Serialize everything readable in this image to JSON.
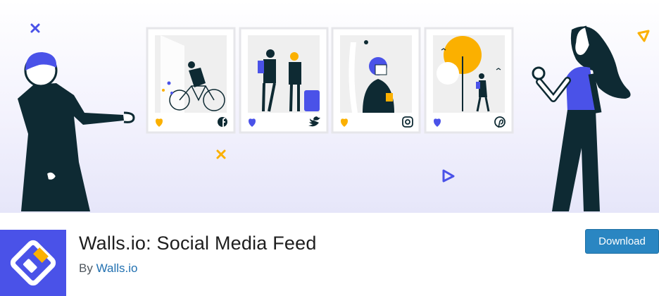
{
  "plugin": {
    "title": "Walls.io: Social Media Feed",
    "by_prefix": "By",
    "author": "Walls.io",
    "download_label": "Download"
  },
  "colors": {
    "accent_blue": "#4a52e8",
    "brand_orange": "#fbb000",
    "dark_figure": "#0e2a33",
    "download_button": "#2a86c2",
    "author_link": "#2271b1"
  },
  "banner": {
    "cards": [
      {
        "heart_color": "#fbb000",
        "network_icon": "facebook-icon"
      },
      {
        "heart_color": "#4a52e8",
        "network_icon": "twitter-icon"
      },
      {
        "heart_color": "#fbb000",
        "network_icon": "instagram-icon"
      },
      {
        "heart_color": "#4a52e8",
        "network_icon": "pinterest-icon"
      }
    ]
  }
}
